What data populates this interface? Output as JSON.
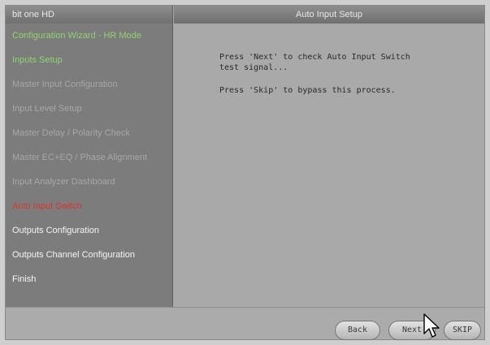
{
  "window": {
    "left_title": "bit one HD",
    "right_title": "Auto Input Setup"
  },
  "sidebar": {
    "items": [
      {
        "label": "Configuration Wizard - HR Mode",
        "state": "done"
      },
      {
        "label": "Inputs Setup",
        "state": "done"
      },
      {
        "label": "Master Input Configuration",
        "state": "pending"
      },
      {
        "label": "Input Level Setup",
        "state": "pending"
      },
      {
        "label": "Master Delay / Polarity Check",
        "state": "pending"
      },
      {
        "label": "Master EC+EQ / Phase Alignment",
        "state": "pending"
      },
      {
        "label": "Input Analyzer Dashboard",
        "state": "pending"
      },
      {
        "label": "Auto Input Switch",
        "state": "active"
      },
      {
        "label": "Outputs Configuration",
        "state": "upcoming"
      },
      {
        "label": "Outputs Channel Configuration",
        "state": "upcoming"
      },
      {
        "label": "Finish",
        "state": "upcoming"
      }
    ]
  },
  "main": {
    "line1": "Press 'Next' to check Auto Input Switch\ntest signal...",
    "line2": "Press 'Skip' to bypass this process."
  },
  "footer": {
    "back_label": "Back",
    "next_label": "Next",
    "skip_label": "SKIP"
  },
  "colors": {
    "done": "#8fd36c",
    "pending": "#a7a7a7",
    "active": "#e0322e",
    "upcoming": "#f4f4f4"
  }
}
